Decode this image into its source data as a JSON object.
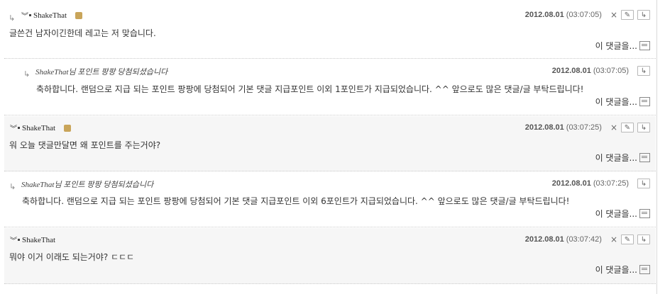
{
  "comments": [
    {
      "author": "ShakeThat",
      "date": "2012.08.01",
      "time": "(03:07:05)",
      "text": "글쓴건 남자이긴한데 레고는 저 맞습니다.",
      "more": "이 댓글을..."
    },
    {
      "header": "ShakeThat님 포인트 팡팡 당첨되셨습니다",
      "date": "2012.08.01",
      "time": "(03:07:05)",
      "text": "축하합니다. 랜덤으로 지급 되는 포인트 팡팡에 당첨되어 기본 댓글 지급포인트 이외 1포인트가 지급되었습니다. ^^ 앞으로도 많은 댓글/글 부탁드립니다!",
      "more": "이 댓글을..."
    },
    {
      "author": "ShakeThat",
      "date": "2012.08.01",
      "time": "(03:07:25)",
      "text": "워 오늘 댓글만달면 왜 포인트를 주는거야?",
      "more": "이 댓글을..."
    },
    {
      "header": "ShakeThat님 포인트 팡팡 당첨되셨습니다",
      "date": "2012.08.01",
      "time": "(03:07:25)",
      "text": "축하합니다. 랜덤으로 지급 되는 포인트 팡팡에 당첨되어 기본 댓글 지급포인트 이외 6포인트가 지급되었습니다. ^^ 앞으로도 많은 댓글/글 부탁드립니다!",
      "more": "이 댓글을..."
    },
    {
      "author": "ShakeThat",
      "date": "2012.08.01",
      "time": "(03:07:42)",
      "text": "뭐야 이거 이래도 되는거야? ㄷㄷㄷ",
      "more": "이 댓글을..."
    }
  ],
  "icons": {
    "reply_arrow": "reply-arrow-icon",
    "delete": "close-icon",
    "edit": "edit-icon",
    "reply": "reply-icon",
    "more": "document-icon",
    "level_badge": "level-badge-icon"
  }
}
